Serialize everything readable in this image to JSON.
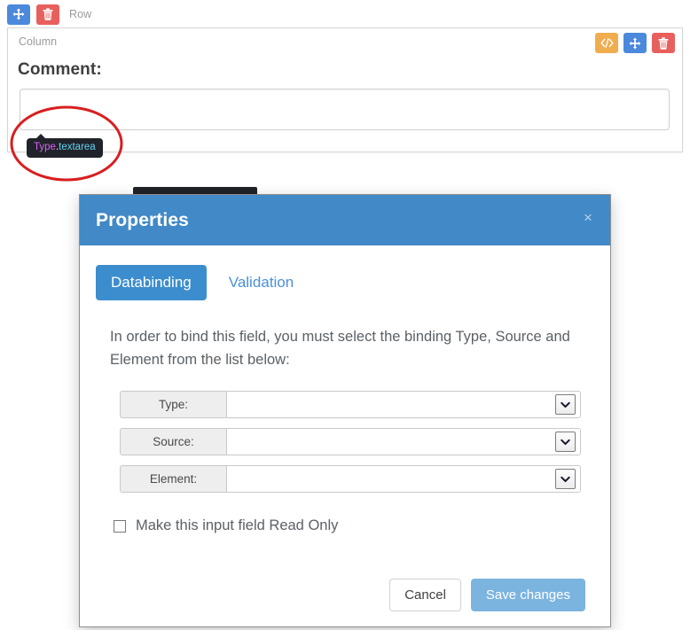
{
  "colors": {
    "primary_blue": "#4189c7",
    "tab_active_blue": "#3c8dcd",
    "link_blue": "#4a90d9",
    "btn_blue": "#7cb4e0",
    "icon_blue": "#4b89dc",
    "icon_red": "#e8605d",
    "icon_orange": "#f0ad4e",
    "annotation_red": "#d81f20",
    "tooltip_bg": "#21232a",
    "tooltip_key": "#d661f5",
    "tooltip_value": "#5fd3f3",
    "panel_border": "#d6d6d6",
    "muted_text": "#9a9a9a"
  },
  "builder": {
    "row": {
      "label": "Row",
      "tools": [
        {
          "name": "move-icon",
          "glyph": "move"
        },
        {
          "name": "trash-icon",
          "glyph": "trash"
        }
      ]
    },
    "column": {
      "label": "Column",
      "tools": [
        {
          "name": "code-icon",
          "glyph": "code"
        },
        {
          "name": "move-icon",
          "glyph": "move"
        },
        {
          "name": "trash-icon",
          "glyph": "trash"
        }
      ]
    },
    "field": {
      "label": "Comment:",
      "value": "",
      "placeholder": ""
    },
    "tooltip": {
      "key": "Type",
      "separator": ".",
      "value": "textarea"
    }
  },
  "modal": {
    "title": "Properties",
    "close_label": "×",
    "tabs": [
      {
        "label": "Databinding",
        "active": true
      },
      {
        "label": "Validation",
        "active": false
      }
    ],
    "intro": "In order to bind this field, you must select the binding Type, Source and Element from the list below:",
    "fields": [
      {
        "label": "Type:",
        "value": "",
        "options": []
      },
      {
        "label": "Source:",
        "value": "",
        "options": []
      },
      {
        "label": "Element:",
        "value": "",
        "options": []
      }
    ],
    "readonly": {
      "label": "Make this input field Read Only",
      "checked": false
    },
    "footer": {
      "cancel_label": "Cancel",
      "save_label": "Save changes"
    }
  }
}
